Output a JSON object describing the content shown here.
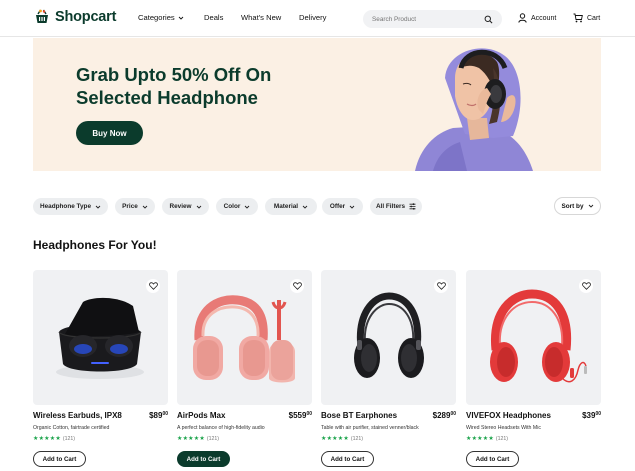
{
  "brand": {
    "name": "Shopcart",
    "color": "#0b3b2c"
  },
  "nav": [
    {
      "label": "Categories",
      "has_dropdown": true
    },
    {
      "label": "Deals"
    },
    {
      "label": "What's New"
    },
    {
      "label": "Delivery"
    }
  ],
  "search": {
    "placeholder": "Search Product",
    "icon": "search-icon"
  },
  "account": {
    "label": "Account",
    "icon": "user-icon"
  },
  "cart": {
    "label": "Cart",
    "icon": "cart-icon"
  },
  "hero": {
    "title": "Grab Upto 50% Off On Selected Headphone",
    "button": "Buy Now",
    "background": "#fbf0e4"
  },
  "filters": [
    {
      "label": "Headphone Type",
      "icon": "chevron-down-icon"
    },
    {
      "label": "Price",
      "icon": "chevron-down-icon"
    },
    {
      "label": "Review",
      "icon": "chevron-down-icon"
    },
    {
      "label": "Color",
      "icon": "chevron-down-icon"
    },
    {
      "label": "Material",
      "icon": "chevron-down-icon"
    },
    {
      "label": "Offer",
      "icon": "chevron-down-icon"
    },
    {
      "label": "All Filters",
      "icon": "sliders-icon"
    }
  ],
  "sort": {
    "label": "Sort by",
    "icon": "chevron-down-icon"
  },
  "section": {
    "title": "Headphones For You!"
  },
  "products": [
    {
      "name": "Wireless Earbuds, IPX8",
      "price_whole": "$89",
      "price_cents": "00",
      "description": "Organic Cotton, fairtrade certified",
      "stars": "★★★★★",
      "reviews": "(121)",
      "button": "Add to Cart",
      "button_filled": false
    },
    {
      "name": "AirPods Max",
      "price_whole": "$559",
      "price_cents": "00",
      "description": "A perfect balance of high-fidelity audio",
      "stars": "★★★★★",
      "reviews": "(121)",
      "button": "Add to Cart",
      "button_filled": true
    },
    {
      "name": "Bose BT Earphones",
      "price_whole": "$289",
      "price_cents": "00",
      "description": "Table with air purifier, stained venner/black",
      "stars": "★★★★★",
      "reviews": "(121)",
      "button": "Add to Cart",
      "button_filled": false
    },
    {
      "name": "VIVEFOX Headphones",
      "price_whole": "$39",
      "price_cents": "00",
      "description": "Wired Stereo Headsets With Mic",
      "stars": "★★★★★",
      "reviews": "(121)",
      "button": "Add to Cart",
      "button_filled": false
    }
  ]
}
